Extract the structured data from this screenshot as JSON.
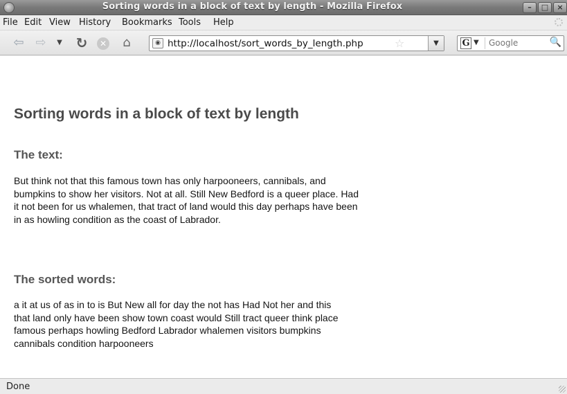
{
  "window": {
    "title": "Sorting words in a block of text by length - Mozilla Firefox"
  },
  "menu": {
    "items": [
      {
        "label": "File"
      },
      {
        "label": "Edit"
      },
      {
        "label": "View"
      },
      {
        "label": "History"
      },
      {
        "label": "Bookmarks"
      },
      {
        "label": "Tools"
      },
      {
        "label": "Help"
      }
    ]
  },
  "toolbar": {
    "url": "http://localhost/sort_words_by_length.php",
    "search_placeholder": "Google",
    "search_engine_letter": "G"
  },
  "page": {
    "heading": "Sorting words in a block of text by length",
    "text_heading": "The text:",
    "text_body": "But think not that this famous town has only harpooneers, cannibals, and bumpkins to show her visitors. Not at all. Still New Bedford is a queer place. Had it not been for us whalemen, that tract of land would this day perhaps have been in as howling condition as the coast of Labrador.",
    "sorted_heading": "The sorted words:",
    "sorted_body": "a it at us of as in to is But New all for day the not has Had Not her and this that land only have been show town coast would Still tract queer think place famous perhaps howling Bedford Labrador whalemen visitors bumpkins cannibals condition harpooneers"
  },
  "status": {
    "text": "Done"
  },
  "colors": {
    "title_bar": "#7a7a7a",
    "heading": "#4a4a4a"
  }
}
